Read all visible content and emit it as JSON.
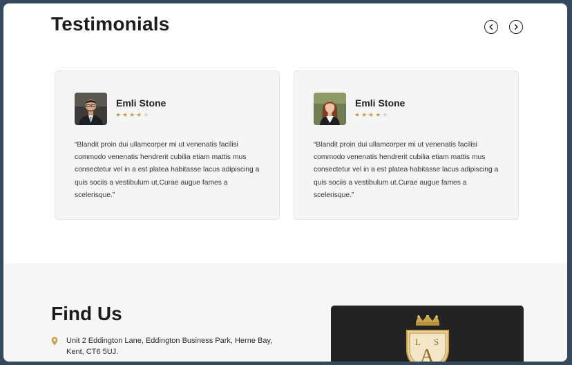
{
  "testimonials": {
    "title": "Testimonials",
    "cards": [
      {
        "name": "Emli Stone",
        "rating": 3.5,
        "max_rating": 5,
        "quote": "“Blandit proin dui ullamcorper mi ut venenatis facilisi commodo venenatis hendrerit cubilia etiam mattis mus consectetur vel in a est platea habitasse lacus adipiscing a quis sociis a vestibulum ut.Curae augue fames a scelerisque.”"
      },
      {
        "name": "Emli Stone",
        "rating": 3.5,
        "max_rating": 5,
        "quote": "“Blandit proin dui ullamcorper mi ut venenatis facilisi commodo venenatis hendrerit cubilia etiam mattis mus consectetur vel in a est platea habitasse lacus adipiscing a quis sociis a vestibulum ut.Curae augue fames a scelerisque.”"
      }
    ],
    "icons": {
      "prev": "chevron-left-circle-icon",
      "next": "chevron-right-circle-icon"
    }
  },
  "find_us": {
    "title": "Find Us",
    "address": "Unit 2 Eddington Lane, Eddington Business Park, Herne Bay, Kent, CT6 5UJ.",
    "address_icon": "map-pin-icon",
    "logo_text": "LAS"
  },
  "colors": {
    "star": "#c9a24a",
    "star_empty": "#d2d2d2",
    "heading": "#1d1d1d",
    "frame": "#34495e",
    "logo_bg": "#232323"
  }
}
